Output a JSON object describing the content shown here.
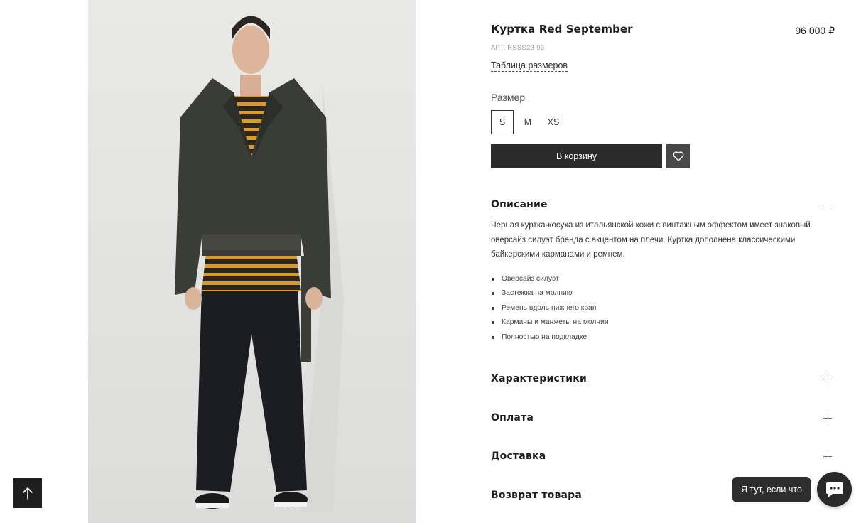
{
  "product": {
    "title": "Куртка Red September",
    "price": "96 000 ₽",
    "sku": "АРТ. RSSS23-03",
    "size_chart_link": "Таблица размеров",
    "size_label": "Размер",
    "sizes": [
      "S",
      "M",
      "XS"
    ],
    "selected_size": "S",
    "add_to_cart": "В корзину",
    "favorite_icon": "heart-icon"
  },
  "description": {
    "title": "Описание",
    "text": "Черная куртка-косуха из итальянской кожи с винтажным эффектом имеет знаковый оверсайз силуэт бренда с акцентом на плечи. Куртка дополнена классическими байкерскими карманами и ремнем.",
    "bullets": [
      "Оверсайз силуэт",
      "Застежка на молнию",
      "Ремень вдоль нижнего края",
      "Карманы и манжеты на молнии",
      "Полностью на подкладке"
    ]
  },
  "accordions": [
    {
      "title": "Характеристики"
    },
    {
      "title": "Оплата"
    },
    {
      "title": "Доставка"
    },
    {
      "title": "Возврат товара"
    }
  ],
  "chat": {
    "bubble_text": "Я тут, если что",
    "icon": "chat-icon"
  },
  "scroll_top_icon": "arrow-up-icon",
  "colors": {
    "button_dark": "#2b2b2b",
    "favorite_bg": "#484848",
    "photo_bg": "#e8e8e6",
    "stripe_orange": "#e0a62e"
  }
}
